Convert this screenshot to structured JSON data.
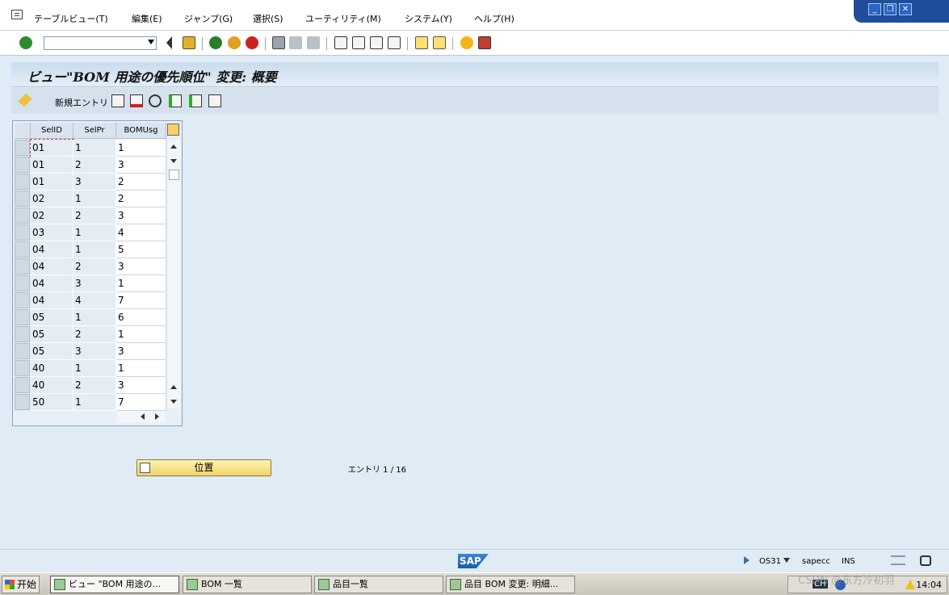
{
  "menubar": {
    "items": [
      {
        "label": "テーブルビュー(T)"
      },
      {
        "label": "編集(E)"
      },
      {
        "label": "ジャンプ(G)"
      },
      {
        "label": "選択(S)"
      },
      {
        "label": "ユーティリティ(M)"
      },
      {
        "label": "システム(Y)"
      },
      {
        "label": "ヘルプ(H)"
      }
    ]
  },
  "toolbar": {
    "command_value": ""
  },
  "title": "ビュー\"BOM 用途の優先順位\" 変更: 概要",
  "app_toolbar": {
    "new_entry_label": "新規エントリ"
  },
  "table": {
    "columns": [
      "SelID",
      "SelPr",
      "BOMUsg"
    ],
    "rows": [
      [
        "01",
        "1",
        "1"
      ],
      [
        "01",
        "2",
        "3"
      ],
      [
        "01",
        "3",
        "2"
      ],
      [
        "02",
        "1",
        "2"
      ],
      [
        "02",
        "2",
        "3"
      ],
      [
        "03",
        "1",
        "4"
      ],
      [
        "04",
        "1",
        "5"
      ],
      [
        "04",
        "2",
        "3"
      ],
      [
        "04",
        "3",
        "1"
      ],
      [
        "04",
        "4",
        "7"
      ],
      [
        "05",
        "1",
        "6"
      ],
      [
        "05",
        "2",
        "1"
      ],
      [
        "05",
        "3",
        "3"
      ],
      [
        "40",
        "1",
        "1"
      ],
      [
        "40",
        "2",
        "3"
      ],
      [
        "50",
        "1",
        "7"
      ]
    ]
  },
  "position_button_label": "位置",
  "entry_count": "エントリ 1 / 16",
  "status": {
    "logo": "SAP",
    "transaction": "OS31",
    "system": "sapecc",
    "mode": "INS"
  },
  "taskbar": {
    "start_label": "开始",
    "tasks": [
      {
        "label": "ビュー \"BOM 用途の..."
      },
      {
        "label": "BOM 一覧"
      },
      {
        "label": "品目一覧"
      },
      {
        "label": "品目 BOM 変更: 明細..."
      }
    ],
    "lang": "CH",
    "clock": "14:04"
  },
  "watermark": "CSDN @东方冷初羽"
}
